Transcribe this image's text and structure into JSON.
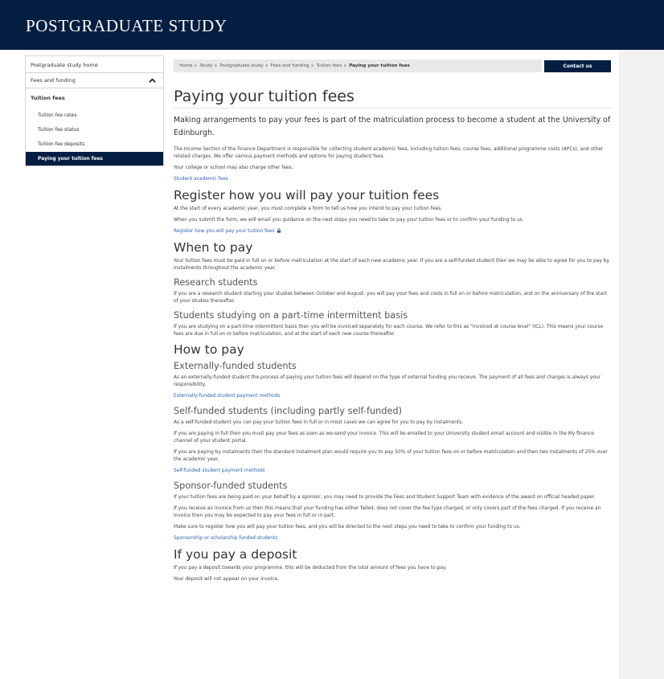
{
  "header": {
    "title": "POSTGRADUATE STUDY"
  },
  "sidebar": {
    "home": "Postgraduate study home",
    "section": "Fees and funding",
    "parent": "Tuition fees",
    "items": [
      "Tuition fee rates",
      "Tuition fee status",
      "Tuition fee deposits",
      "Paying your tuition fees"
    ],
    "active_index": 3
  },
  "breadcrumb": {
    "items": [
      "Home",
      "Study",
      "Postgraduate study",
      "Fees and funding",
      "Tuition fees"
    ],
    "current": "Paying your tuition fees",
    "separator": "▸"
  },
  "contact_button": "Contact us",
  "page": {
    "title": "Paying your tuition fees",
    "lead": "Making arrangements to pay your fees is part of the matriculation process to become a student at the University of Edinburgh.",
    "intro": [
      "The Income Section of the Finance Department is responsible for collecting student academic fees, including tuition fees, course fees, additional programme costs (APCs), and other related charges. We offer various payment methods and options for paying student fees.",
      "Your college or school may also charge other fees."
    ],
    "intro_link": "Student academic fees",
    "register": {
      "heading": "Register how you will pay your tuition fees",
      "p1": "At the start of every academic year, you must complete a form to tell us how you intend to pay your tuition fees.",
      "p2": "When you submit the form, we will email you guidance on the next steps you need to take to pay your tuition fees or to confirm your funding to us.",
      "link": "Register how you will pay your tuition fees"
    },
    "when": {
      "heading": "When to pay",
      "p1": "Your tuition fees must be paid in full on or before matriculation at the start of each new academic year. If you are a self-funded student then we may be able to agree for you to pay by instalments throughout the academic year.",
      "research_heading": "Research students",
      "research_p": "If you are a research student starting your studies between October and August, you will pay your fees and costs in full on or before matriculation, and on the anniversary of the start of your studies thereafter.",
      "parttime_heading": "Students studying on a part-time intermittent basis",
      "parttime_p": "If you are studying on a part-time intermittent basis then you will be invoiced separately for each course. We refer to this as \"invoiced at course level\" (ICL). This means your course fees are due in full on or before matriculation, and at the start of each new course thereafter."
    },
    "how": {
      "heading": "How to pay",
      "ext_heading": "Externally-funded students",
      "ext_p": "As an externally-funded student the process of paying your tuition fees will depend on the type of external funding you receive. The payment of all fees and charges is always your responsibility.",
      "ext_link": "Externally-funded student payment methods",
      "self_heading": "Self-funded students (including partly self-funded)",
      "self_p1": "As a self-funded student you can pay your tuition fees in full or in most cases we can agree for you to pay by instalments.",
      "self_p2": "If you are paying in full then you must pay your fees as soon as we send your invoice. This will be emailed to your University student email account and visible in the My finance channel of your student portal.",
      "self_p3": "If you are paying by instalments then the standard instalment plan would require you to pay 50% of your tuition fees on or before matriculation and then two instalments of 25% over the academic year.",
      "self_link": "Self-funded student payment methods",
      "sponsor_heading": "Sponsor-funded students",
      "sponsor_p1": "If your tuition fees are being paid on your behalf by a sponsor, you may need to provide the Fees and Student Support Team with evidence of the award on official headed paper.",
      "sponsor_p2": "If you receive an invoice from us then this means that your funding has either failed, does not cover the fee type charged, or only covers part of the fees charged. If you receive an invoice then you may be expected to pay your fees in full or in part.",
      "sponsor_p3": "Make sure to register how you will pay your tuition fees, and you will be directed to the next steps you need to take to confirm your funding to us.",
      "sponsor_link": "Sponsorship or scholarship funded students"
    },
    "deposit": {
      "heading": "If you pay a deposit",
      "p1": "If you pay a deposit towards your programme, this will be deducted from the total amount of fees you have to pay.",
      "p2": "Your deposit will not appear on your invoice."
    }
  },
  "colors": {
    "navy": "#041e42",
    "link": "#2e63b3",
    "breadcrumb_bg": "#e8e8e8"
  }
}
